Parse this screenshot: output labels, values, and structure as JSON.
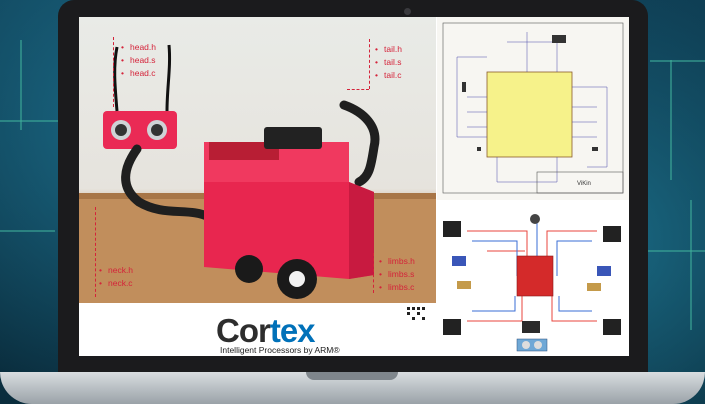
{
  "photo_labels": {
    "head": [
      "head.h",
      "head.s",
      "head.c"
    ],
    "tail": [
      "tail.h",
      "tail.s",
      "tail.c"
    ],
    "neck": [
      "neck.h",
      "neck.c"
    ],
    "limbs": [
      "limbs.h",
      "limbs.s",
      "limbs.c"
    ]
  },
  "logo": {
    "word_prefix": "Cor",
    "word_suffix": "tex",
    "tagline": "Intelligent Processors by ARM®"
  },
  "schematic": {
    "title_block": "ViKin"
  },
  "colors": {
    "label_red": "#d4233a",
    "robot_red": "#e8264f",
    "logo_blue": "#0071b9",
    "wire_red": "#e8463c",
    "wire_blue": "#3a6ed6"
  }
}
